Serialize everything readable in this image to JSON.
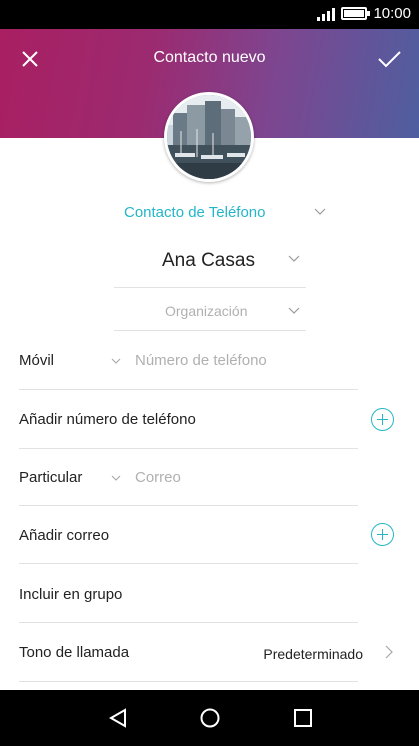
{
  "status_bar": {
    "time": "10:00",
    "signal_bars": 4,
    "battery_level": 0.9
  },
  "header": {
    "title": "Contacto nuevo",
    "close_icon": "close-icon",
    "save_icon": "checkmark-icon"
  },
  "avatar": {
    "description_icon": "contact-photo"
  },
  "account": {
    "label": "Contacto de Teléfono"
  },
  "name": {
    "value": "Ana Casas"
  },
  "organization": {
    "placeholder": "Organización"
  },
  "phone": {
    "type_label": "Móvil",
    "placeholder": "Número de teléfono"
  },
  "add_phone": {
    "label": "Añadir número de teléfono"
  },
  "email": {
    "type_label": "Particular",
    "placeholder": "Correo"
  },
  "add_email": {
    "label": "Añadir correo"
  },
  "group": {
    "label": "Incluir en grupo"
  },
  "ringtone": {
    "label": "Tono de llamada",
    "value": "Predeterminado"
  },
  "colors": {
    "accent": "#24b6c8",
    "header_start": "#a91f62",
    "header_end": "#4e5fa0"
  },
  "nav": {
    "back_icon": "back-triangle-icon",
    "home_icon": "home-circle-icon",
    "recents_icon": "recents-square-icon"
  }
}
